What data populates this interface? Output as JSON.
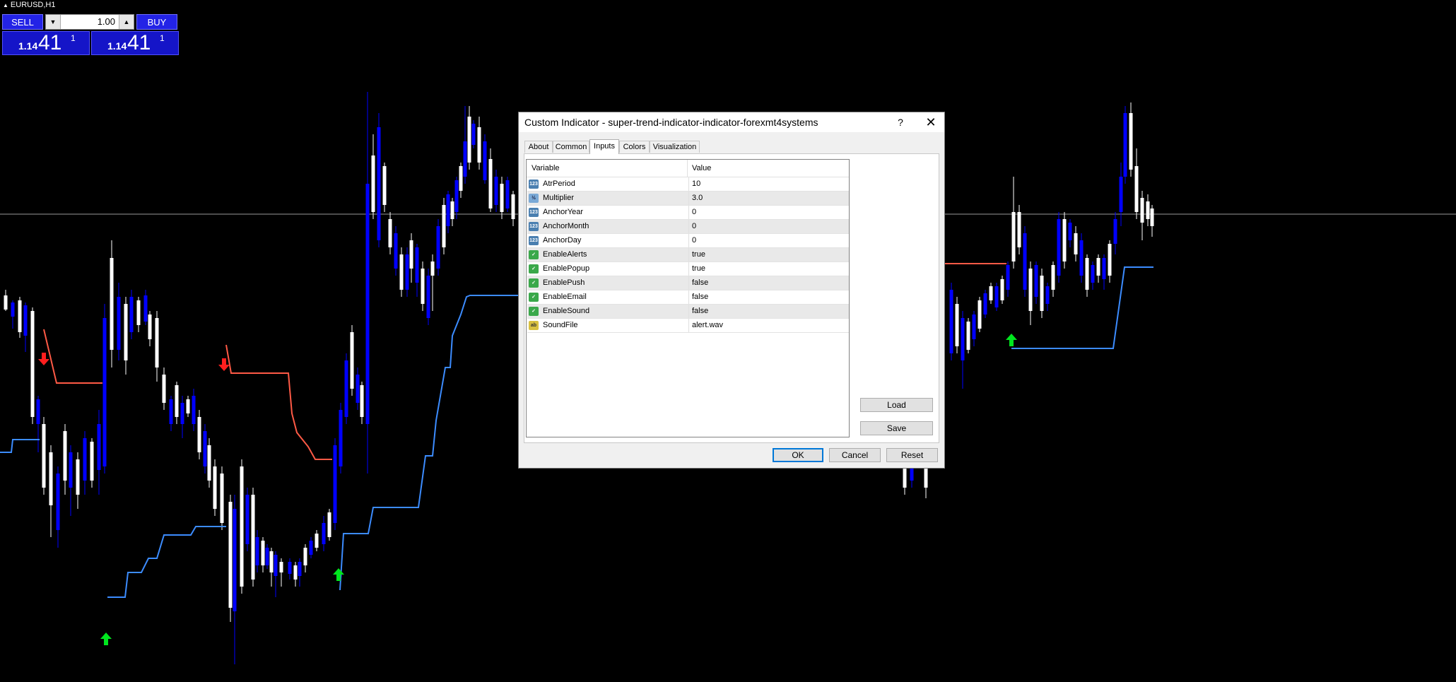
{
  "chart": {
    "symbol": "EURUSD,H1"
  },
  "trade_panel": {
    "sell_label": "SELL",
    "buy_label": "BUY",
    "lot_value": "1.00",
    "sell_price": {
      "small": "1.14",
      "big": "41",
      "sup": "1"
    },
    "buy_price": {
      "small": "1.14",
      "big": "41",
      "sup": "1"
    }
  },
  "dialog": {
    "title": "Custom Indicator - super-trend-indicator-indicator-forexmt4systems",
    "help": "?",
    "close": "✕",
    "tabs": [
      {
        "label": "About",
        "active": false
      },
      {
        "label": "Common",
        "active": false
      },
      {
        "label": "Inputs",
        "active": true
      },
      {
        "label": "Colors",
        "active": false
      },
      {
        "label": "Visualization",
        "active": false
      }
    ],
    "grid": {
      "col_variable": "Variable",
      "col_value": "Value",
      "rows": [
        {
          "icon": "int-icon",
          "name": "AtrPeriod",
          "value": "10"
        },
        {
          "icon": "double-icon",
          "name": "Multiplier",
          "value": "3.0"
        },
        {
          "icon": "int-icon",
          "name": "AnchorYear",
          "value": "0"
        },
        {
          "icon": "int-icon",
          "name": "AnchorMonth",
          "value": "0"
        },
        {
          "icon": "int-icon",
          "name": "AnchorDay",
          "value": "0"
        },
        {
          "icon": "bool-icon",
          "name": "EnableAlerts",
          "value": "true"
        },
        {
          "icon": "bool-icon",
          "name": "EnablePopup",
          "value": "true"
        },
        {
          "icon": "bool-icon",
          "name": "EnablePush",
          "value": "false"
        },
        {
          "icon": "bool-icon",
          "name": "EnableEmail",
          "value": "false"
        },
        {
          "icon": "bool-icon",
          "name": "EnableSound",
          "value": "false"
        },
        {
          "icon": "string-icon",
          "name": "SoundFile",
          "value": "alert.wav"
        }
      ]
    },
    "buttons": {
      "load": "Load",
      "save": "Save",
      "ok": "OK",
      "cancel": "Cancel",
      "reset": "Reset"
    }
  },
  "colors": {
    "background": "#000000",
    "bull_candle": "#ffffff",
    "bear_candle": "#0000ff",
    "supertrend_up": "#3c8cff",
    "supertrend_down": "#ff5a46",
    "arrow_up": "#00e61e",
    "arrow_down": "#ff1e1e",
    "dialog_bg": "#f0f0f0"
  }
}
